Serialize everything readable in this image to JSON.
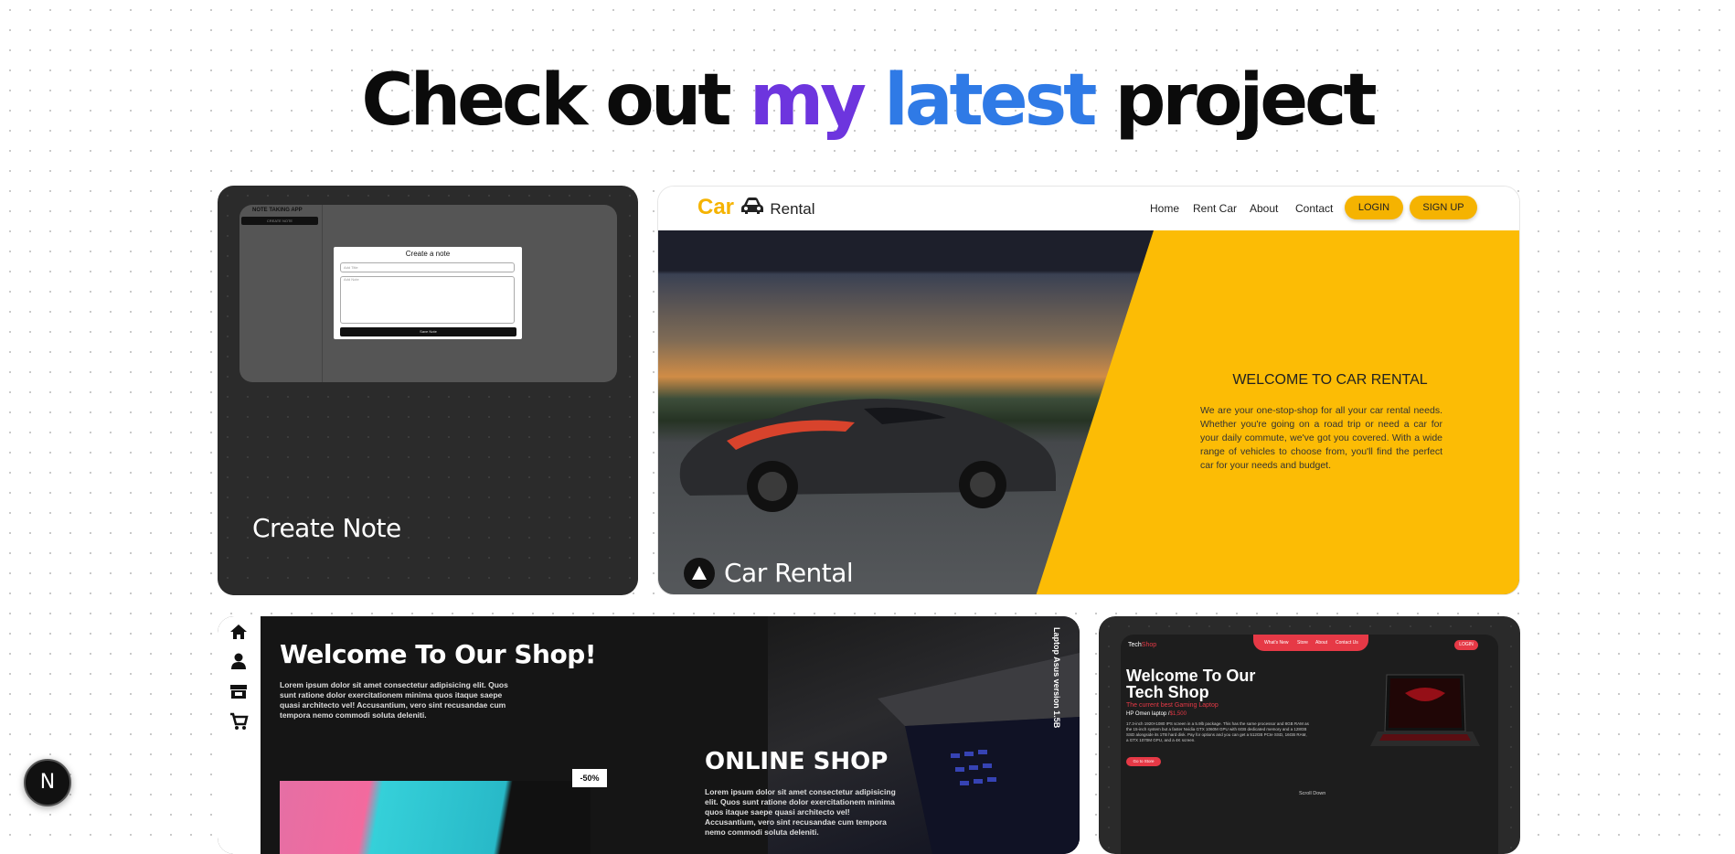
{
  "headline": {
    "part1": "Check out ",
    "part2": "my",
    "part3": " latest",
    "part4": " project"
  },
  "projects": [
    {
      "title": "Create Note",
      "preview": {
        "app_title": "NOTE TAKING APP",
        "side_button": "CREATE NOTE",
        "modal_title": "Create a note",
        "title_placeholder": "Add Title",
        "note_placeholder": "Add Note",
        "save_button": "Save Note"
      }
    },
    {
      "title": "Car Rental",
      "preview": {
        "logo_car": "Car",
        "logo_rental": "Rental",
        "menu": [
          "Home",
          "Rent Car",
          "About",
          "Contact"
        ],
        "login": "LOGIN",
        "signup": "SIGN UP",
        "welcome": "WELCOME TO CAR RENTAL",
        "description": "We are your one-stop-shop for all your car rental needs. Whether you're going on a road trip or need a car for your daily commute, we've got you covered. With a wide range of vehicles to choose from, you'll find the perfect car for your needs and budget."
      }
    },
    {
      "title": "",
      "preview": {
        "heading": "Welcome To Our Shop!",
        "intro": "Lorem ipsum dolor sit amet consectetur adipisicing elit. Quos sunt ratione dolor exercitationem minima quos itaque saepe quasi architecto vel! Accusantium, vero sint recusandae cum tempora nemo commodi soluta deleniti.",
        "online_heading": "ONLINE SHOP",
        "online_text": "Lorem ipsum dolor sit amet consectetur adipisicing elit. Quos sunt ratione dolor exercitationem minima quos itaque saepe quasi architecto vel! Accusantium, vero sint recusandae cum tempora nemo commodi soluta deleniti.",
        "vertical_text": "Laptop Asus version 1.5B",
        "badge": "-50%"
      }
    },
    {
      "title": "",
      "preview": {
        "brand_a": "Tech",
        "brand_b": "Shop",
        "nav": [
          "What's New",
          "Store",
          "About",
          "Contact Us"
        ],
        "login": "LOGIN",
        "heading_line1": "Welcome To Our",
        "heading_line2": "Tech Shop",
        "tagline": "The current best Gaming Laptop",
        "model": "HP Omen laptop /",
        "price": "$1,500",
        "description": "17.3-inch 1920×1080 IPS screen in a 5.9lb package. This has the same processor and 8GB RAM as the 15-inch system but a faster Nvidia GTX 1060M GPU with 6GB dedicated memory and a 128GB SSD alongside its 1TB hard disk. Pay for options and you can get a 512GB PCIe SSD, 16GB RAM, a GTX 1070M GPU, and a 4K screen.",
        "cta": "Go to Store",
        "scroll": "Scroll Down"
      }
    }
  ],
  "floating_badge": "N",
  "colors": {
    "purple": "#6d35de",
    "blue": "#2f7ae6",
    "yellow": "#fcbc05",
    "red": "#e63946"
  },
  "icons": [
    "home-icon",
    "user-icon",
    "store-icon",
    "cart-icon",
    "car-icon",
    "triangle-icon"
  ]
}
